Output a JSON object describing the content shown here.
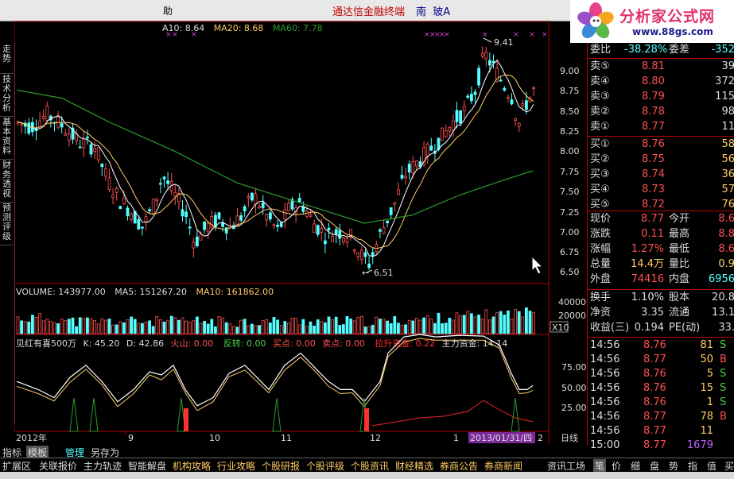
{
  "title_bar": {
    "left_fragment": "助",
    "app_name": "通达信金融终端",
    "stock_name_a": "南",
    "stock_name_b": "玻A"
  },
  "logo": {
    "name": "分析家公式网",
    "url": "www.88gs.com"
  },
  "side_tabs": [
    "走势",
    "技术分析",
    "基本资料",
    "财务透视",
    "预测评级"
  ],
  "main_chart": {
    "ma_line": {
      "ma10": "A10: 8.64",
      "ma20": "MA20: 8.68",
      "ma60": "MA60: 7.78"
    },
    "price_ticks": [
      "9.00",
      "8.75",
      "8.50",
      "8.25",
      "8.00",
      "7.75",
      "7.50",
      "7.25",
      "7.00",
      "6.75",
      "6.50"
    ],
    "high_marker": "9.41",
    "low_marker": "6.51"
  },
  "volume_panel": {
    "volume": "VOLUME: 143977.00",
    "ma5": "MA5: 151267.20",
    "ma10": "MA10: 161862.00",
    "ticks": [
      "40000",
      "20000"
    ],
    "multiplier": "X10"
  },
  "indicator_panel": {
    "name": "见红有喜500万",
    "k": "K: 45.20",
    "d": "D: 42.86",
    "huoshan": "火山: 0.00",
    "fanzhuan": "反转: 0.00",
    "maidian": "买点: 0.00",
    "maidian2": "卖点: 0.00",
    "lasheng": "拉升资金: 0.22",
    "zhuli": "主力资金: 14.14",
    "ticks": [
      "75.00",
      "50.00",
      "25.00"
    ]
  },
  "time_axis": {
    "labels": [
      "2012年",
      "9",
      "10",
      "11",
      "12",
      "1"
    ],
    "current_date": "2013/01/31/四",
    "next": "2",
    "period": "日线"
  },
  "bottom_tabs": [
    "指标",
    "模板",
    "管理",
    "另存为"
  ],
  "nav_links": [
    "扩展区",
    "关联报价",
    "主力轨迹",
    "智能解盘",
    "机构攻略",
    "行业攻略",
    "个股研报",
    "个股评级",
    "个股资讯",
    "财经精选",
    "券商公告",
    "券商新闻",
    "资讯工场"
  ],
  "right_tabs": [
    "笔",
    "价",
    "细",
    "盘",
    "势",
    "指",
    "值",
    "买"
  ],
  "quote": {
    "weibi": {
      "label": "委比",
      "value": "-38.28%",
      "label2": "委差",
      "value2": "-352"
    },
    "asks": [
      {
        "label": "卖⑤",
        "price": "8.81",
        "vol": "39"
      },
      {
        "label": "卖④",
        "price": "8.80",
        "vol": "372"
      },
      {
        "label": "卖③",
        "price": "8.79",
        "vol": "115"
      },
      {
        "label": "卖②",
        "price": "8.78",
        "vol": "98"
      },
      {
        "label": "卖①",
        "price": "8.77",
        "vol": "11"
      }
    ],
    "bids": [
      {
        "label": "买①",
        "price": "8.76",
        "vol": "58"
      },
      {
        "label": "买②",
        "price": "8.75",
        "vol": "56"
      },
      {
        "label": "买③",
        "price": "8.74",
        "vol": "36"
      },
      {
        "label": "买④",
        "price": "8.73",
        "vol": "57"
      },
      {
        "label": "买⑤",
        "price": "8.72",
        "vol": "76"
      }
    ],
    "stats1": [
      {
        "l1": "现价",
        "v1": "8.77",
        "l2": "今开",
        "v2": "8.6"
      },
      {
        "l1": "涨跌",
        "v1": "0.11",
        "l2": "最高",
        "v2": "8.8"
      },
      {
        "l1": "涨幅",
        "v1": "1.27%",
        "l2": "最低",
        "v2": "8.6"
      },
      {
        "l1": "总量",
        "v1": "14.4万",
        "l2": "量比",
        "v2": "0.9"
      },
      {
        "l1": "外盘",
        "v1": "74416",
        "l2": "内盘",
        "v2": "6956"
      }
    ],
    "stats2": [
      {
        "l1": "换手",
        "v1": "1.10%",
        "l2": "股本",
        "v2": "20.8"
      },
      {
        "l1": "净资",
        "v1": "3.35",
        "l2": "流通",
        "v2": "13.1"
      },
      {
        "l1": "收益(三)",
        "v1": "0.194",
        "l2": "PE(动)",
        "v2": "33."
      }
    ],
    "ticks": [
      {
        "time": "14:56",
        "price": "8.76",
        "vol": "81",
        "dir": "S"
      },
      {
        "time": "14:56",
        "price": "8.77",
        "vol": "50",
        "dir": "B"
      },
      {
        "time": "14:56",
        "price": "8.76",
        "vol": "5",
        "dir": "S"
      },
      {
        "time": "14:56",
        "price": "8.76",
        "vol": "15",
        "dir": "S"
      },
      {
        "time": "14:56",
        "price": "8.76",
        "vol": "1",
        "dir": "S"
      },
      {
        "time": "14:56",
        "price": "8.77",
        "vol": "78",
        "dir": "B"
      },
      {
        "time": "14:56",
        "price": "8.77",
        "vol": "11",
        "dir": ""
      },
      {
        "time": "15:00",
        "price": "8.77",
        "vol": "1679",
        "dir": ""
      }
    ]
  },
  "colors": {
    "up": "#ff5050",
    "down": "#54ffff",
    "ma_white": "#ffffff",
    "ma_yellow": "#ffcc66",
    "ma_green": "#2e9a2e",
    "frame": "#b00000"
  }
}
